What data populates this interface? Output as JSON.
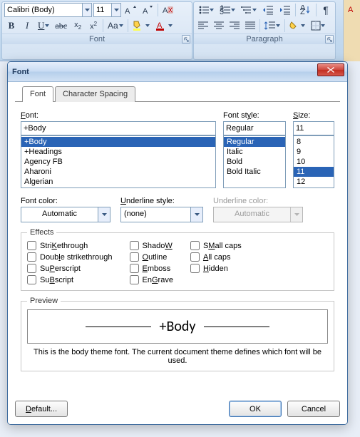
{
  "ribbon": {
    "font_name": "Calibri (Body)",
    "font_size": "11",
    "group_font_label": "Font",
    "group_paragraph_label": "Paragraph"
  },
  "dialog": {
    "title": "Font",
    "tabs": {
      "font": "Font",
      "spacing": "Character Spacing"
    },
    "labels": {
      "font": "Font:",
      "font_mn": "F",
      "style": "Font style:",
      "style_mn": "y",
      "size": "Size:",
      "size_mn": "S",
      "font_color": "Font color:",
      "underline_style": "Underline style:",
      "underline_style_mn": "U",
      "underline_color": "Underline color:"
    },
    "values": {
      "font": "+Body",
      "style": "Regular",
      "size": "11",
      "font_color_label": "Automatic",
      "underline_style": "(none)",
      "underline_color": "Automatic"
    },
    "font_list": [
      "+Body",
      "+Headings",
      "Agency FB",
      "Aharoni",
      "Algerian"
    ],
    "font_list_selected": "+Body",
    "style_list": [
      "Regular",
      "Italic",
      "Bold",
      "Bold Italic"
    ],
    "style_list_selected": "Regular",
    "size_list": [
      "8",
      "9",
      "10",
      "11",
      "12"
    ],
    "size_list_selected": "11",
    "effects": {
      "legend": "Effects",
      "items": [
        [
          {
            "label": "Strikethrough",
            "mn": "K",
            "pre": "Stri",
            "post": "ethrough"
          },
          {
            "label": "Double strikethrough",
            "mn": "l",
            "pre": "Doub",
            "post": "e strikethrough"
          },
          {
            "label": "Superscript",
            "mn": "P",
            "pre": "Su",
            "post": "erscript"
          },
          {
            "label": "Subscript",
            "mn": "B",
            "pre": "Su",
            "post": "script"
          }
        ],
        [
          {
            "label": "Shadow",
            "mn": "W",
            "pre": "Shado",
            "post": ""
          },
          {
            "label": "Outline",
            "mn": "O",
            "pre": "",
            "post": "utline"
          },
          {
            "label": "Emboss",
            "mn": "E",
            "pre": "",
            "post": "mboss"
          },
          {
            "label": "Engrave",
            "mn": "G",
            "pre": "En",
            "post": "rave"
          }
        ],
        [
          {
            "label": "Small caps",
            "mn": "M",
            "pre": "S",
            "post": "all caps"
          },
          {
            "label": "All caps",
            "mn": "A",
            "pre": "",
            "post": "ll caps"
          },
          {
            "label": "Hidden",
            "mn": "H",
            "pre": "",
            "post": "idden"
          }
        ]
      ]
    },
    "preview": {
      "legend": "Preview",
      "sample": "+Body",
      "hint": "This is the body theme font. The current document theme defines which font will be used."
    },
    "buttons": {
      "default": "Default...",
      "default_mn": "D",
      "ok": "OK",
      "cancel": "Cancel"
    }
  }
}
